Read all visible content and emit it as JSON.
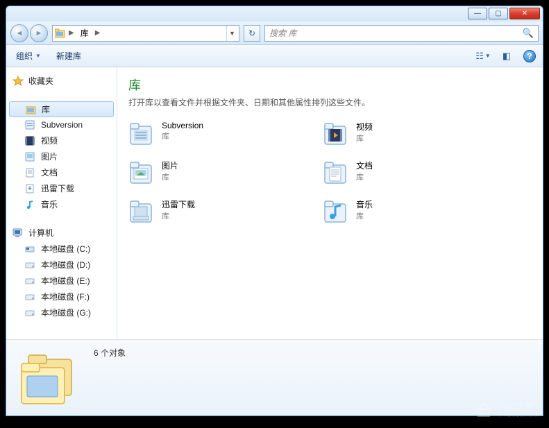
{
  "titlebar": {
    "min": "—",
    "max": "▢",
    "close": "✕"
  },
  "nav": {
    "back": "◄",
    "forward": "►",
    "breadcrumb_root": "库",
    "refresh": "↻",
    "search_placeholder": "搜索 库",
    "search_glyph": "🔍"
  },
  "toolbar": {
    "organize": "组织",
    "dd": "▼",
    "newlib": "新建库",
    "view_glyph": "☷",
    "preview_glyph": "◧",
    "help": "?"
  },
  "sidebar": {
    "favorites_label": "收藏夹",
    "libraries_label": "库",
    "lib_items": [
      {
        "label": "Subversion",
        "icon": "subversion"
      },
      {
        "label": "视频",
        "icon": "video"
      },
      {
        "label": "图片",
        "icon": "picture"
      },
      {
        "label": "文档",
        "icon": "document"
      },
      {
        "label": "迅雷下载",
        "icon": "download"
      },
      {
        "label": "音乐",
        "icon": "music"
      }
    ],
    "computer_label": "计算机",
    "drives": [
      {
        "label": "本地磁盘 (C:)",
        "icon": "sysdrive"
      },
      {
        "label": "本地磁盘 (D:)",
        "icon": "drive"
      },
      {
        "label": "本地磁盘 (E:)",
        "icon": "drive"
      },
      {
        "label": "本地磁盘 (F:)",
        "icon": "drive"
      },
      {
        "label": "本地磁盘 (G:)",
        "icon": "drive"
      }
    ]
  },
  "main": {
    "title": "库",
    "description": "打开库以查看文件并根据文件夹、日期和其他属性排列这些文件。",
    "type_label": "库",
    "items": [
      {
        "name": "Subversion",
        "icon": "subversion"
      },
      {
        "name": "视频",
        "icon": "video"
      },
      {
        "name": "图片",
        "icon": "picture"
      },
      {
        "name": "文档",
        "icon": "document"
      },
      {
        "name": "迅雷下载",
        "icon": "download"
      },
      {
        "name": "音乐",
        "icon": "music"
      }
    ]
  },
  "details": {
    "count_text": "6 个对象"
  },
  "watermark": {
    "brand": "系统之家",
    "sub": "XITONGZHIJIA"
  }
}
